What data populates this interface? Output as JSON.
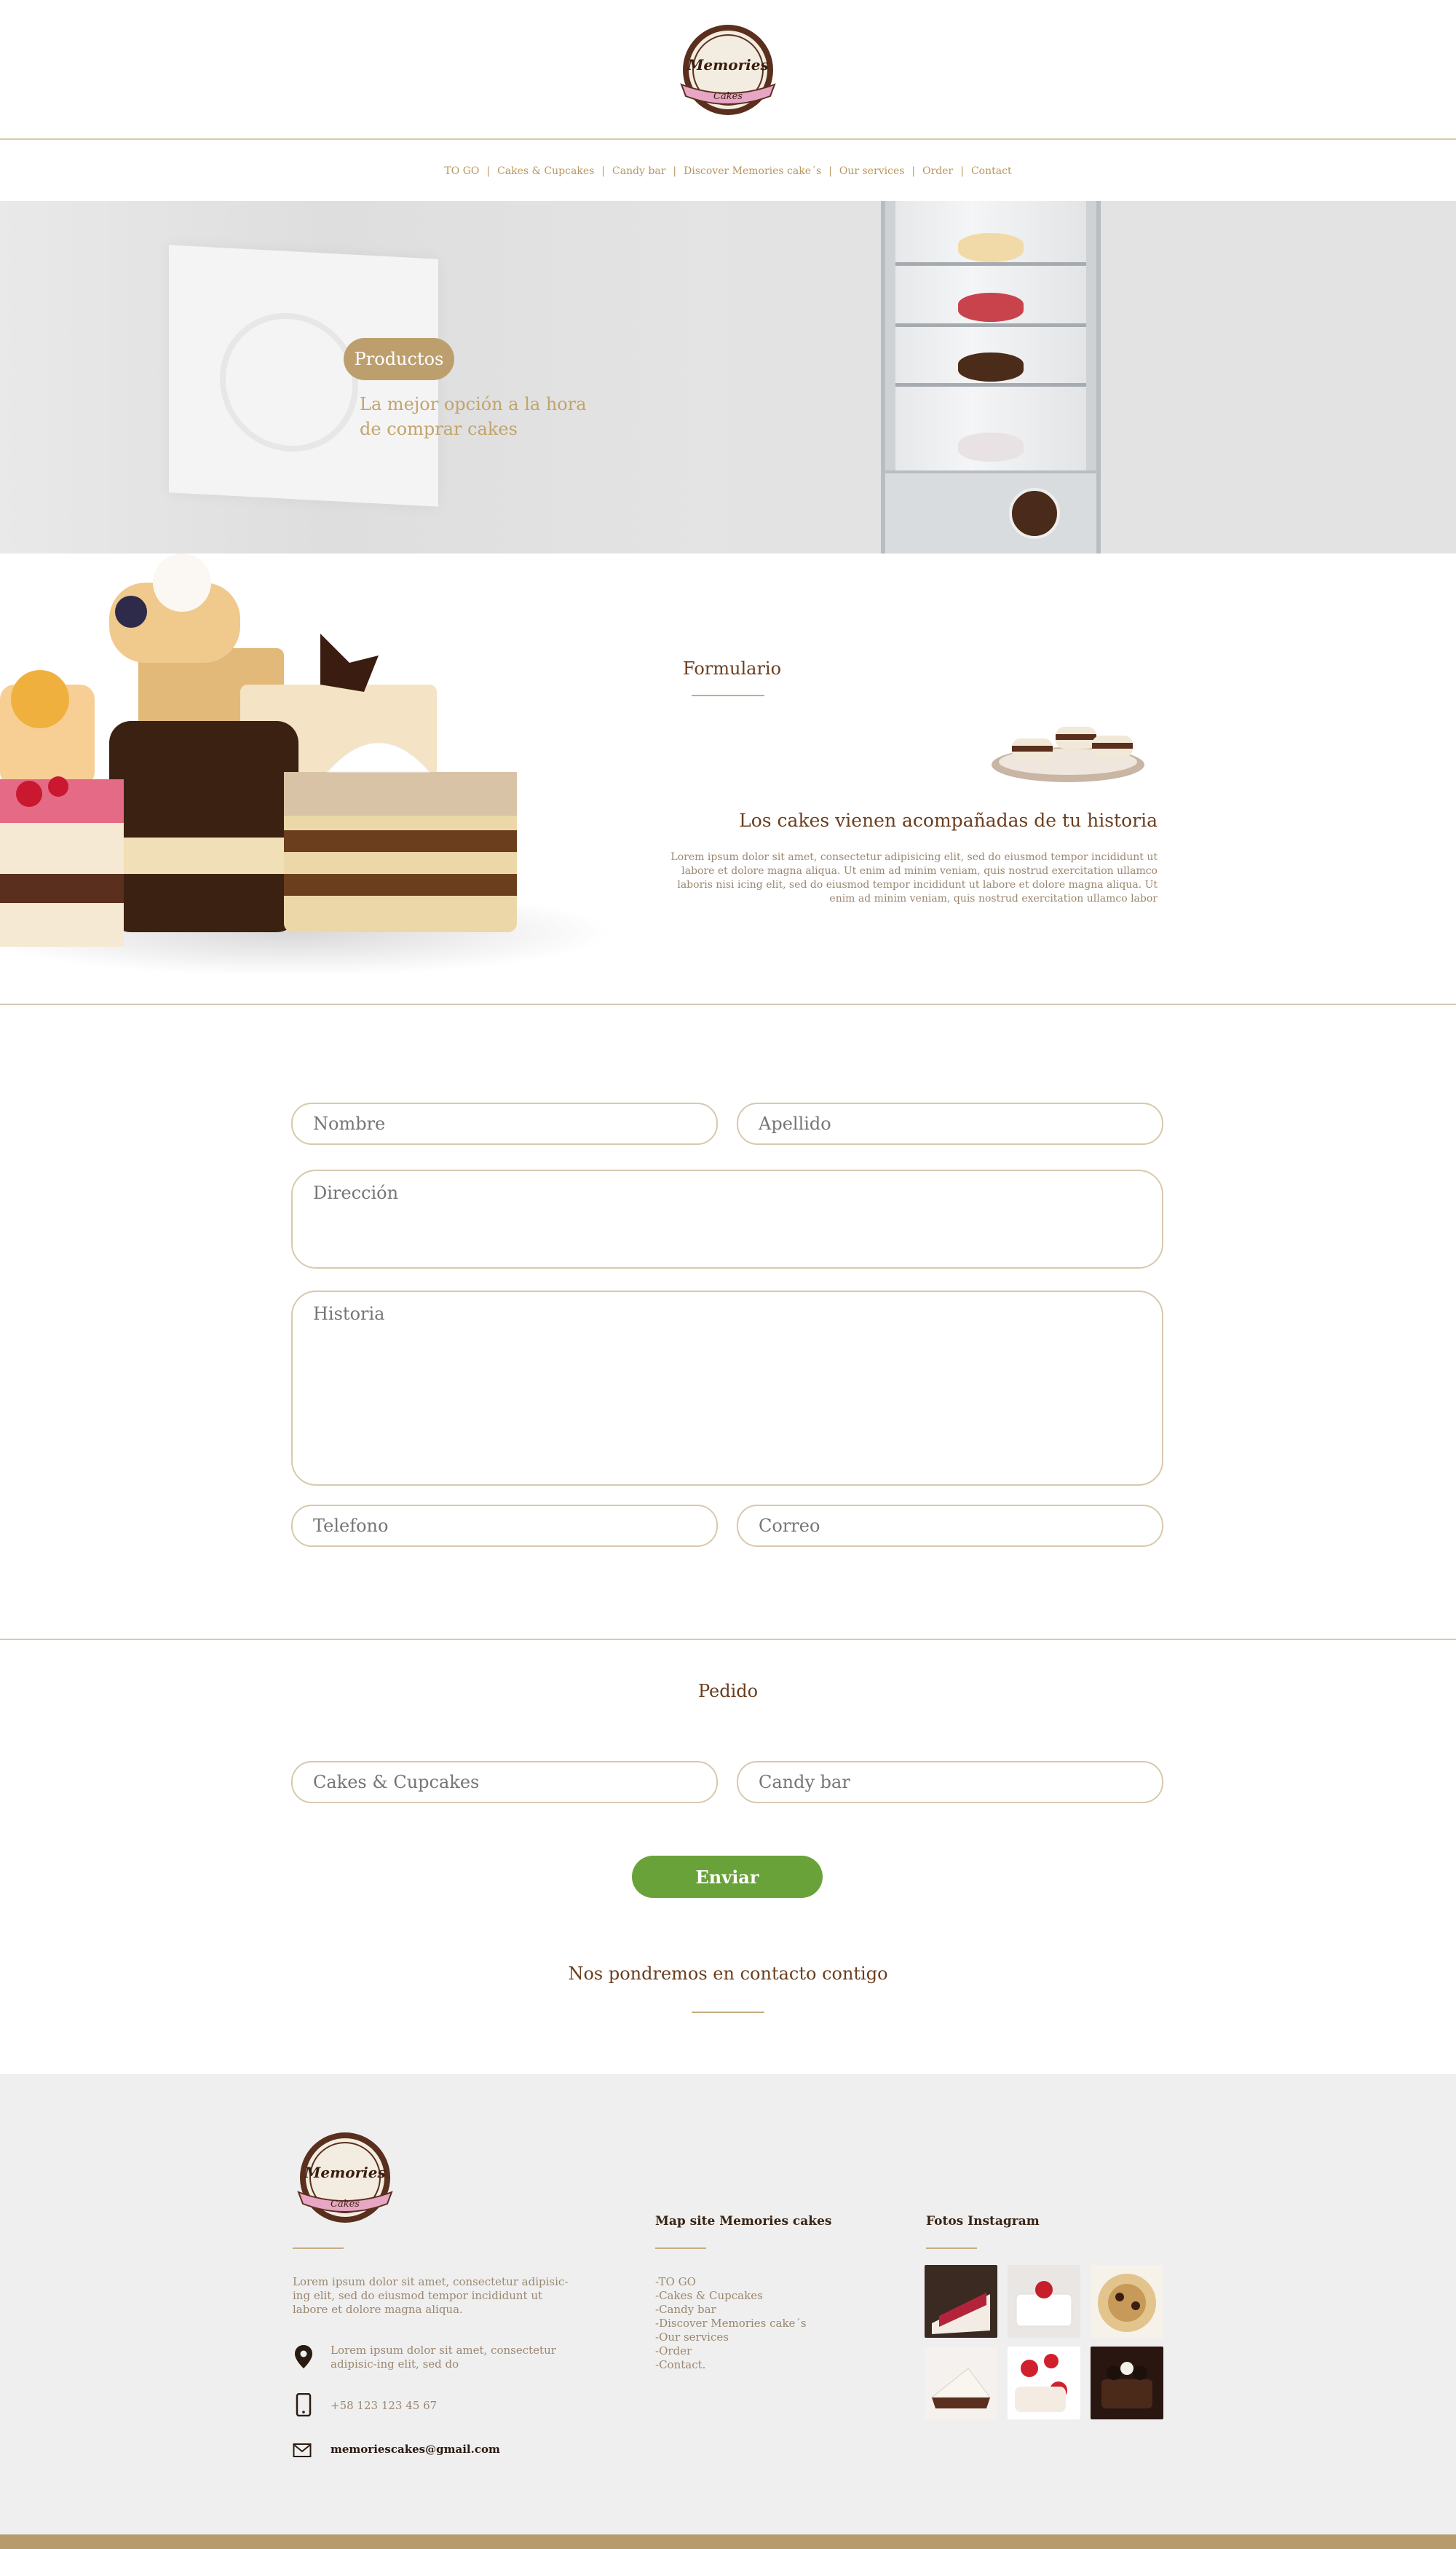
{
  "brand": {
    "logo_text": "Memories",
    "logo_sub": "Cakes"
  },
  "nav": {
    "items": [
      "TO GO",
      "Cakes & Cupcakes",
      "Candy bar",
      "Discover Memories cake´s",
      "Our services",
      "Order",
      "Contact"
    ],
    "separator": "|"
  },
  "hero": {
    "badge": "Productos",
    "subtitle": "La mejor opción a la hora de comprar cakes"
  },
  "intro": {
    "title": "Formulario",
    "heading": "Los cakes vienen acompañadas de tu historia",
    "text": "Lorem ipsum dolor sit amet, consectetur adipisicing elit, sed do eiusmod tempor incididunt ut labore et dolore magna aliqua. Ut enim ad minim veniam, quis nostrud exercitation ullamco laboris nisi icing elit, sed do eiusmod tempor incididunt ut labore et dolore magna aliqua. Ut enim ad minim veniam, quis nostrud exercitation ullamco labor"
  },
  "form": {
    "nombre_placeholder": "Nombre",
    "apellido_placeholder": "Apellido",
    "direccion_placeholder": "Dirección",
    "historia_placeholder": "Historia",
    "telefono_placeholder": "Telefono",
    "correo_placeholder": "Correo"
  },
  "order": {
    "title": "Pedido",
    "cakes_placeholder": "Cakes & Cupcakes",
    "candy_placeholder": "Candy bar",
    "send_label": "Enviar",
    "contact_note": "Nos pondremos en contacto contigo"
  },
  "footer": {
    "about": "Lorem ipsum dolor sit amet, consectetur adipisic-ing elit, sed do eiusmod tempor incididunt ut labore et dolore magna aliqua.",
    "address": "Lorem ipsum dolor sit amet, consectetur adipisic-ing elit, sed do",
    "phone": "+58 123 123 45 67",
    "email": "memoriescakes@gmail.com",
    "map_title": "Map site Memories cakes",
    "map_links": [
      "-TO GO",
      "-Cakes & Cupcakes",
      "-Candy bar",
      "-Discover Memories cake´s",
      "-Our services",
      "-Order",
      "-Contact."
    ],
    "insta_title": "Fotos Instagram"
  },
  "colors": {
    "accent": "#bd9f6e",
    "brown": "#6b3e1e",
    "green": "#6aa23a",
    "line": "#d8c9ae",
    "footer_bg": "#efefef"
  }
}
